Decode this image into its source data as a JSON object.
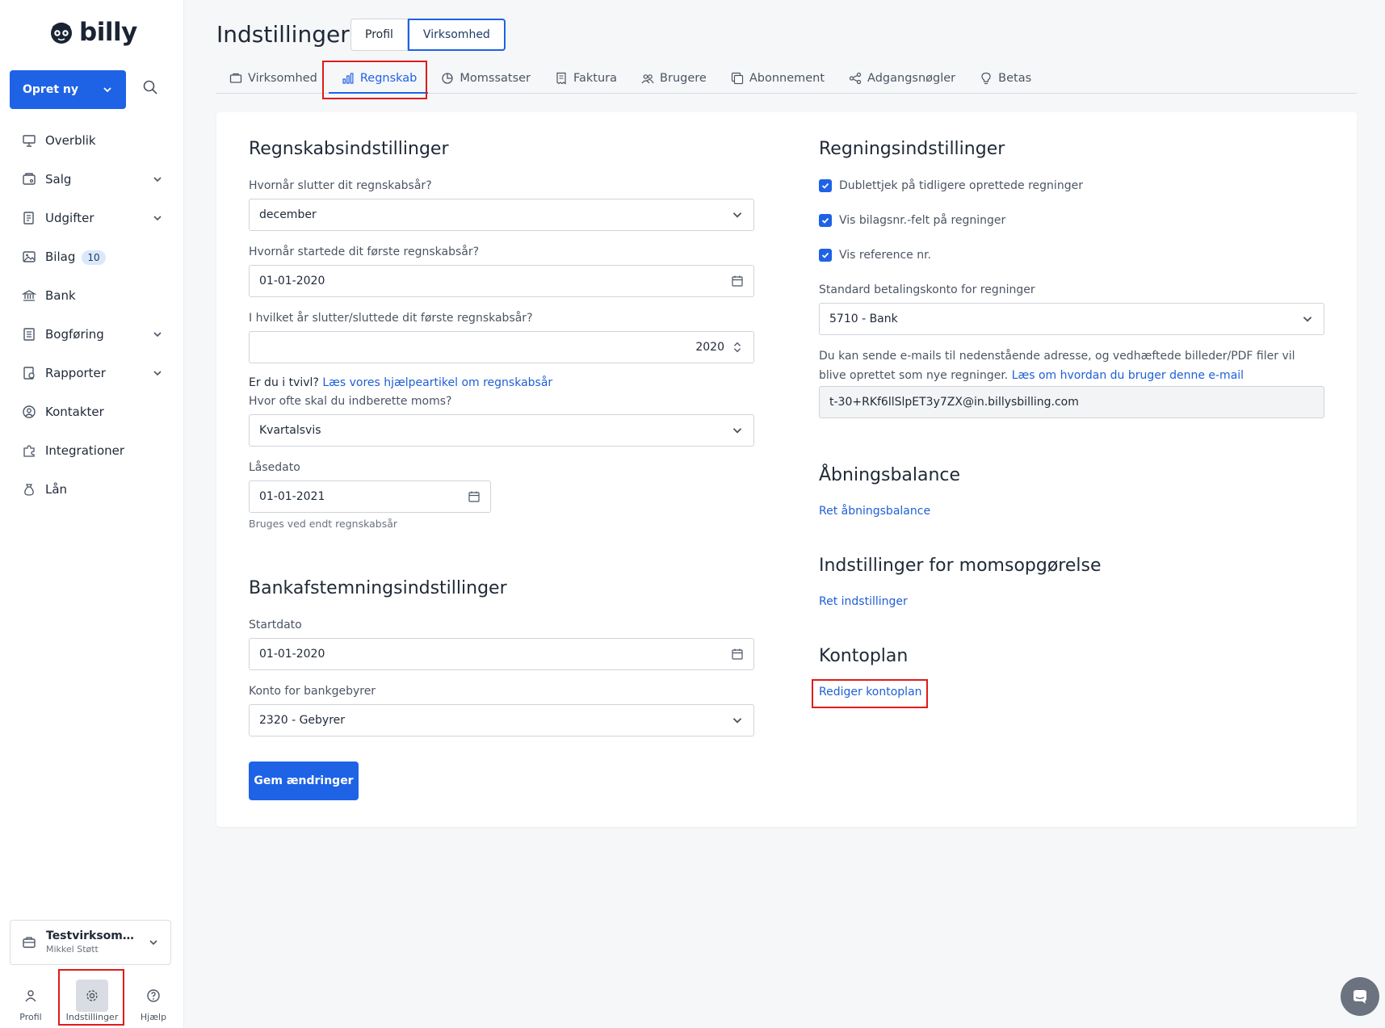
{
  "brand": {
    "name": "billy"
  },
  "sidebar": {
    "create_label": "Opret ny",
    "items": [
      {
        "label": "Overblik",
        "icon": "dashboard-icon",
        "chevron": false
      },
      {
        "label": "Salg",
        "icon": "sales-icon",
        "chevron": true
      },
      {
        "label": "Udgifter",
        "icon": "expenses-icon",
        "chevron": true
      },
      {
        "label": "Bilag",
        "icon": "image-icon",
        "chevron": false,
        "badge": "10"
      },
      {
        "label": "Bank",
        "icon": "bank-icon",
        "chevron": false
      },
      {
        "label": "Bogføring",
        "icon": "ledger-icon",
        "chevron": true
      },
      {
        "label": "Rapporter",
        "icon": "reports-icon",
        "chevron": true
      },
      {
        "label": "Kontakter",
        "icon": "contacts-icon",
        "chevron": false
      },
      {
        "label": "Integrationer",
        "icon": "puzzle-icon",
        "chevron": false
      },
      {
        "label": "Lån",
        "icon": "moneybag-icon",
        "chevron": false
      }
    ],
    "org": {
      "name": "Testvirksomhe...",
      "user": "Mikkel Støtt"
    },
    "bottom": [
      {
        "label": "Profil",
        "icon": "user-icon"
      },
      {
        "label": "Indstillinger",
        "icon": "gear-icon"
      },
      {
        "label": "Hjælp",
        "icon": "help-icon"
      }
    ]
  },
  "header": {
    "title": "Indstillinger",
    "segments": [
      "Profil",
      "Virksomhed"
    ],
    "tabs": [
      {
        "label": "Virksomhed",
        "icon": "briefcase-icon"
      },
      {
        "label": "Regnskab",
        "icon": "bar-chart-icon"
      },
      {
        "label": "Momssatser",
        "icon": "pie-chart-icon"
      },
      {
        "label": "Faktura",
        "icon": "invoice-icon"
      },
      {
        "label": "Brugere",
        "icon": "users-icon"
      },
      {
        "label": "Abonnement",
        "icon": "subscription-icon"
      },
      {
        "label": "Adgangsnøgler",
        "icon": "share-icon"
      },
      {
        "label": "Betas",
        "icon": "bulb-icon"
      }
    ]
  },
  "accounting": {
    "title": "Regnskabsindstillinger",
    "q_year_end": "Hvornår slutter dit regnskabsår?",
    "year_end_value": "december",
    "q_first_start": "Hvornår startede dit første regnskabsår?",
    "first_start_value": "01-01-2020",
    "q_first_end_year": "I hvilket år slutter/sluttede dit første regnskabsår?",
    "first_end_year_value": "2020",
    "help_prefix": "Er du i tvivl?",
    "help_link": "Læs vores hjælpeartikel om regnskabsår",
    "q_vat_freq": "Hvor ofte skal du indberette moms?",
    "vat_freq_value": "Kvartalsvis",
    "lock_label": "Låsedato",
    "lock_value": "01-01-2021",
    "lock_hint": "Bruges ved endt regnskabsår"
  },
  "bank": {
    "title": "Bankafstemningsindstillinger",
    "start_label": "Startdato",
    "start_value": "01-01-2020",
    "fee_label": "Konto for bankgebyrer",
    "fee_value": "2320 - Gebyrer",
    "save_label": "Gem ændringer"
  },
  "bills": {
    "title": "Regningsindstillinger",
    "checks": [
      "Dublettjek på tidligere oprettede regninger",
      "Vis bilagsnr.-felt på regninger",
      "Vis reference nr."
    ],
    "account_label": "Standard betalingskonto for regninger",
    "account_value": "5710 - Bank",
    "email_text": "Du kan sende e-mails til nedenstående adresse, og vedhæftede billeder/PDF filer vil blive oprettet som nye regninger.",
    "email_link": "Læs om hvordan du bruger denne e-mail",
    "email_value": "t-30+RKf6llSlpET3y7ZX@in.billysbilling.com"
  },
  "opening": {
    "title": "Åbningsbalance",
    "link": "Ret åbningsbalance"
  },
  "vat_report": {
    "title": "Indstillinger for momsopgørelse",
    "link": "Ret indstillinger"
  },
  "chart_of_accounts": {
    "title": "Kontoplan",
    "link": "Rediger kontoplan"
  },
  "colors": {
    "accent": "#1e62e6",
    "highlight": "#e01b1b",
    "link": "#1f5fd6"
  }
}
